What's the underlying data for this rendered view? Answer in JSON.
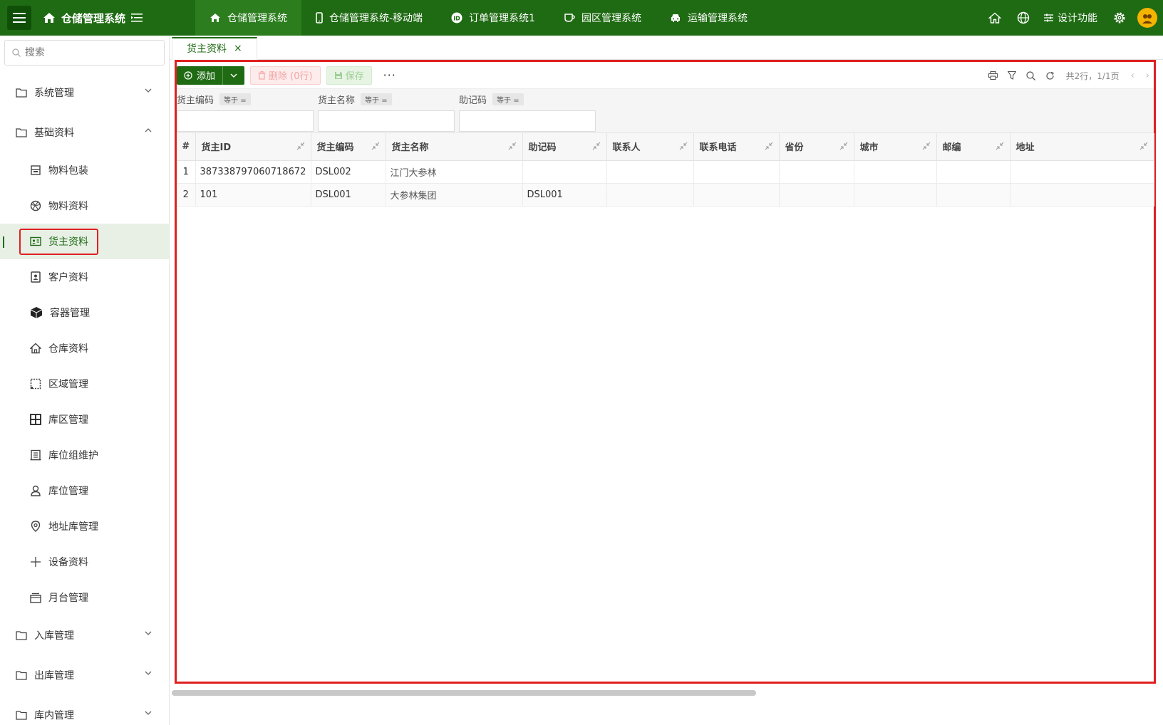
{
  "app": {
    "title": "仓储管理系统"
  },
  "topnav": [
    {
      "label": "仓储管理系统",
      "icon": "home-icon"
    },
    {
      "label": "仓储管理系统-移动端",
      "icon": "mobile-icon"
    },
    {
      "label": "订单管理系统1",
      "icon": "id-icon"
    },
    {
      "label": "园区管理系统",
      "icon": "cup-icon"
    },
    {
      "label": "运输管理系统",
      "icon": "car-icon"
    }
  ],
  "topright": {
    "design_label": "设计功能"
  },
  "sidebar": {
    "search_placeholder": "搜索",
    "groups": [
      {
        "label": "系统管理"
      },
      {
        "label": "基础资料"
      },
      {
        "label": "入库管理"
      },
      {
        "label": "出库管理"
      },
      {
        "label": "库内管理"
      }
    ],
    "items": [
      {
        "label": "物料包装",
        "icon": "package-icon"
      },
      {
        "label": "物料资料",
        "icon": "ball-icon"
      },
      {
        "label": "货主资料",
        "icon": "id-card-icon"
      },
      {
        "label": "客户资料",
        "icon": "contact-icon"
      },
      {
        "label": "容器管理",
        "icon": "cube-icon"
      },
      {
        "label": "仓库资料",
        "icon": "home-icon"
      },
      {
        "label": "区域管理",
        "icon": "area-icon"
      },
      {
        "label": "库区管理",
        "icon": "grid-icon"
      },
      {
        "label": "库位组维护",
        "icon": "list-icon"
      },
      {
        "label": "库位管理",
        "icon": "user-icon"
      },
      {
        "label": "地址库管理",
        "icon": "location-icon"
      },
      {
        "label": "设备资料",
        "icon": "plus-icon"
      },
      {
        "label": "月台管理",
        "icon": "platform-icon"
      }
    ]
  },
  "tab": {
    "label": "货主资料",
    "close": "×"
  },
  "toolbar": {
    "add_label": "添加",
    "delete_label": "删除 (0行)",
    "save_label": "保存",
    "more_label": "···",
    "pagination": "共2行，1/1页"
  },
  "filters": [
    {
      "label": "货主编码",
      "op": "等于 ="
    },
    {
      "label": "货主名称",
      "op": "等于 ="
    },
    {
      "label": "助记码",
      "op": "等于 ="
    }
  ],
  "table": {
    "columns": [
      "#",
      "货主ID",
      "货主编码",
      "货主名称",
      "助记码",
      "联系人",
      "联系电话",
      "省份",
      "城市",
      "邮编",
      "地址"
    ],
    "rows": [
      [
        "1",
        "387338797060718672",
        "DSL002",
        "江门大参林",
        "",
        "",
        "",
        "",
        "",
        "",
        ""
      ],
      [
        "2",
        "101",
        "DSL001",
        "大参林集团",
        "DSL001",
        "",
        "",
        "",
        "",
        "",
        ""
      ]
    ]
  },
  "colors": {
    "primary": "#1f6b13",
    "highlight_border": "#e02020"
  }
}
